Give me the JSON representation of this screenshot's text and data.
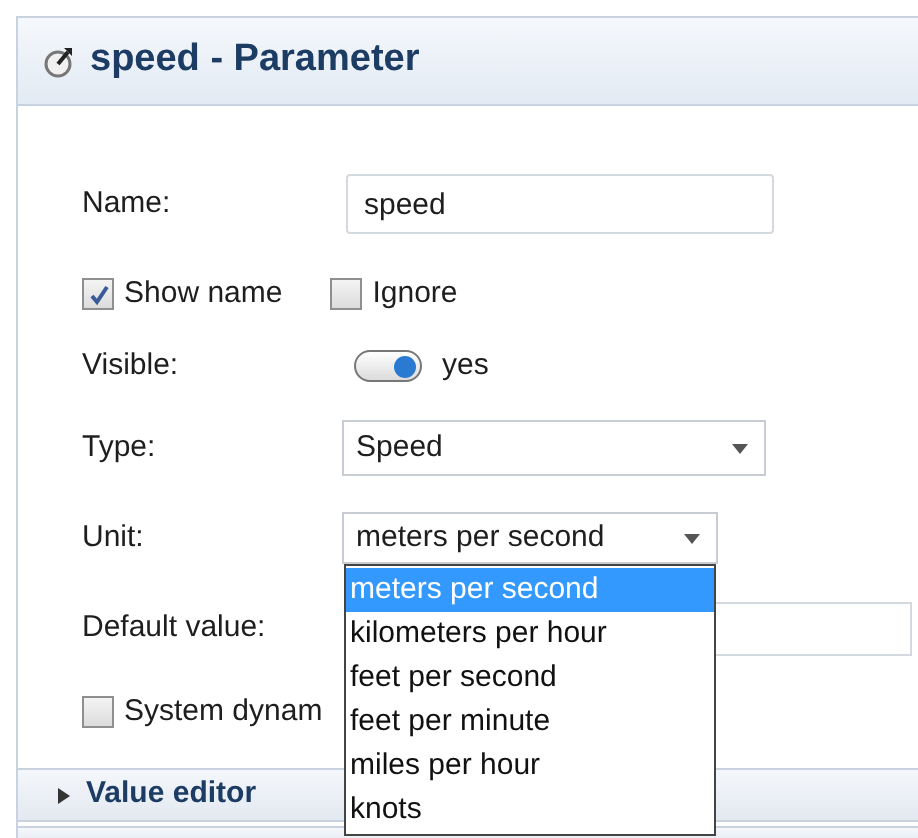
{
  "header": {
    "title": "speed - Parameter"
  },
  "name": {
    "label": "Name:",
    "value": "speed"
  },
  "checkboxes": [
    {
      "label": "Show name",
      "checked": true
    },
    {
      "label": "Ignore",
      "checked": false
    }
  ],
  "visible": {
    "label": "Visible:",
    "on": true,
    "value": "yes"
  },
  "type": {
    "label": "Type:",
    "value": "Speed"
  },
  "unit": {
    "label": "Unit:",
    "value": "meters per second",
    "expanded": true,
    "options": [
      {
        "label": "meters per second",
        "selected": true
      },
      {
        "label": "kilometers per hour",
        "selected": false
      },
      {
        "label": "feet per second",
        "selected": false
      },
      {
        "label": "feet per minute",
        "selected": false
      },
      {
        "label": "miles per hour",
        "selected": false
      },
      {
        "label": "knots",
        "selected": false
      }
    ]
  },
  "default_value": {
    "label": "Default value:"
  },
  "system_dynamics": {
    "label": "System dynam",
    "checked": false
  },
  "sections": [
    {
      "label": "Value editor",
      "expanded": false
    }
  ]
}
